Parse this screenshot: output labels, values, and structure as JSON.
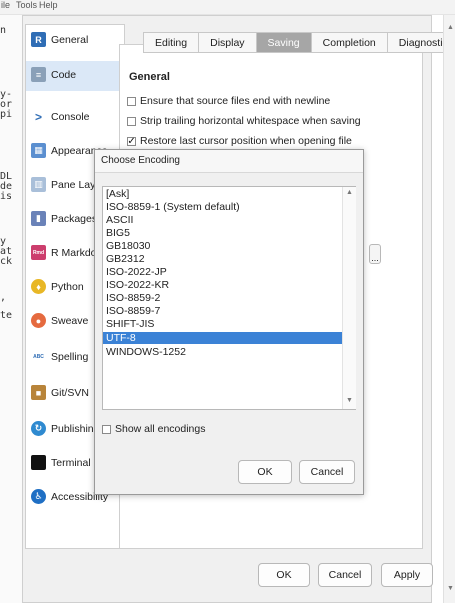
{
  "menu": {
    "items": [
      "ile",
      "Tools",
      "Help"
    ]
  },
  "gutter": {
    "fragments": [
      "n",
      "y-",
      "or",
      "pi",
      "DL",
      "de",
      "is",
      "y",
      "at",
      "ck",
      ",",
      "te"
    ]
  },
  "sidebar": {
    "items": [
      {
        "label": "General",
        "icon": "r-logo-icon",
        "color": "#2f6db5",
        "glyph": "R"
      },
      {
        "label": "Code",
        "icon": "code-icon",
        "color": "#8aa0b8",
        "glyph": "≡",
        "selected": true
      },
      {
        "label": "Console",
        "icon": "console-prompt-icon",
        "color": "#ffffff",
        "glyph": ">"
      },
      {
        "label": "Appearance",
        "icon": "appearance-icon",
        "color": "#5b8fd0",
        "glyph": "▦"
      },
      {
        "label": "Pane Layout",
        "icon": "pane-layout-icon",
        "color": "#a9bfd9",
        "glyph": "▥"
      },
      {
        "label": "Packages",
        "icon": "packages-icon",
        "color": "#6a82b8",
        "glyph": "▮"
      },
      {
        "label": "R Markdown",
        "icon": "rmarkdown-icon",
        "color": "#cc3e6d",
        "glyph": "Rmd"
      },
      {
        "label": "Python",
        "icon": "python-icon",
        "color": "#e8b726",
        "glyph": "♦"
      },
      {
        "label": "Sweave",
        "icon": "sweave-icon",
        "color": "#e56a3f",
        "glyph": "●"
      },
      {
        "label": "Spelling",
        "icon": "spelling-icon",
        "color": "#ffffff",
        "glyph": "ABC"
      },
      {
        "label": "Git/SVN",
        "icon": "git-box-icon",
        "color": "#b8843a",
        "glyph": "■"
      },
      {
        "label": "Publishing",
        "icon": "publishing-icon",
        "color": "#2f8ad0",
        "glyph": "↻"
      },
      {
        "label": "Terminal",
        "icon": "terminal-icon",
        "color": "#111111",
        "glyph": ""
      },
      {
        "label": "Accessibility",
        "icon": "accessibility-icon",
        "color": "#1f6fc4",
        "glyph": "♿"
      }
    ]
  },
  "tabs": [
    "Editing",
    "Display",
    "Saving",
    "Completion",
    "Diagnostics"
  ],
  "active_tab": "Saving",
  "section": {
    "title": "General"
  },
  "options": [
    {
      "label": "Ensure that source files end with newline",
      "checked": false
    },
    {
      "label": "Strip trailing horizontal whitespace when saving",
      "checked": false
    },
    {
      "label": "Restore last cursor position when opening file",
      "checked": true
    }
  ],
  "browse": {
    "label": "..."
  },
  "footer": {
    "ok": "OK",
    "cancel": "Cancel",
    "apply": "Apply"
  },
  "encoding_dialog": {
    "title": "Choose Encoding",
    "items": [
      "[Ask]",
      "ISO-8859-1 (System default)",
      "ASCII",
      "BIG5",
      "GB18030",
      "GB2312",
      "ISO-2022-JP",
      "ISO-2022-KR",
      "ISO-8859-2",
      "ISO-8859-7",
      "SHIFT-JIS",
      "UTF-8",
      "WINDOWS-1252"
    ],
    "selected": "UTF-8",
    "show_all_label": "Show all encodings",
    "show_all_checked": false,
    "ok": "OK",
    "cancel": "Cancel"
  },
  "colors": {
    "selection": "#3b82d6",
    "sidebar_selected": "#dbe8f7",
    "active_tab": "#a6a6a6"
  }
}
